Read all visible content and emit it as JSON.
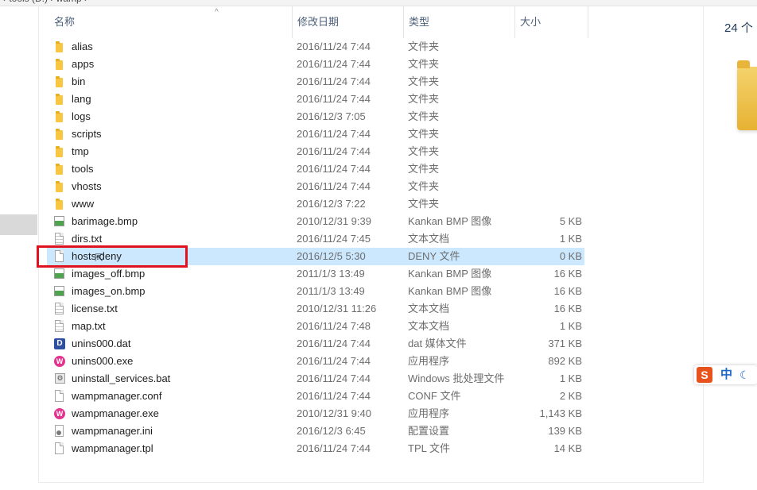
{
  "header": {
    "col_name": "名称",
    "col_date": "修改日期",
    "col_type": "类型",
    "col_size": "大小"
  },
  "files": [
    {
      "name": "alias",
      "date": "2016/11/24 7:44",
      "type": "文件夹",
      "size": "",
      "icon": "folder-icon"
    },
    {
      "name": "apps",
      "date": "2016/11/24 7:44",
      "type": "文件夹",
      "size": "",
      "icon": "folder-icon"
    },
    {
      "name": "bin",
      "date": "2016/11/24 7:44",
      "type": "文件夹",
      "size": "",
      "icon": "folder-icon"
    },
    {
      "name": "lang",
      "date": "2016/11/24 7:44",
      "type": "文件夹",
      "size": "",
      "icon": "folder-icon"
    },
    {
      "name": "logs",
      "date": "2016/12/3 7:05",
      "type": "文件夹",
      "size": "",
      "icon": "folder-icon"
    },
    {
      "name": "scripts",
      "date": "2016/11/24 7:44",
      "type": "文件夹",
      "size": "",
      "icon": "folder-icon"
    },
    {
      "name": "tmp",
      "date": "2016/11/24 7:44",
      "type": "文件夹",
      "size": "",
      "icon": "folder-icon"
    },
    {
      "name": "tools",
      "date": "2016/11/24 7:44",
      "type": "文件夹",
      "size": "",
      "icon": "folder-icon"
    },
    {
      "name": "vhosts",
      "date": "2016/11/24 7:44",
      "type": "文件夹",
      "size": "",
      "icon": "folder-icon"
    },
    {
      "name": "www",
      "date": "2016/12/3 7:22",
      "type": "文件夹",
      "size": "",
      "icon": "folder-icon"
    },
    {
      "name": "barimage.bmp",
      "date": "2010/12/31 9:39",
      "type": "Kankan BMP 图像",
      "size": "5 KB",
      "icon": "bmp-image-icon"
    },
    {
      "name": "dirs.txt",
      "date": "2016/11/24 7:45",
      "type": "文本文档",
      "size": "1 KB",
      "icon": "text-file-icon"
    },
    {
      "name": "hosts.deny",
      "date": "2016/12/5 5:30",
      "type": "DENY 文件",
      "size": "0 KB",
      "icon": "blank-file-icon",
      "selected": true
    },
    {
      "name": "images_off.bmp",
      "date": "2011/1/3 13:49",
      "type": "Kankan BMP 图像",
      "size": "16 KB",
      "icon": "bmp-image-icon"
    },
    {
      "name": "images_on.bmp",
      "date": "2011/1/3 13:49",
      "type": "Kankan BMP 图像",
      "size": "16 KB",
      "icon": "bmp-image-icon"
    },
    {
      "name": "license.txt",
      "date": "2010/12/31 11:26",
      "type": "文本文档",
      "size": "16 KB",
      "icon": "text-file-icon"
    },
    {
      "name": "map.txt",
      "date": "2016/11/24 7:48",
      "type": "文本文档",
      "size": "1 KB",
      "icon": "text-file-icon"
    },
    {
      "name": "unins000.dat",
      "date": "2016/11/24 7:44",
      "type": "dat 媒体文件",
      "size": "371 KB",
      "icon": "dat-file-icon"
    },
    {
      "name": "unins000.exe",
      "date": "2016/11/24 7:44",
      "type": "应用程序",
      "size": "892 KB",
      "icon": "exe-app-icon"
    },
    {
      "name": "uninstall_services.bat",
      "date": "2016/11/24 7:44",
      "type": "Windows 批处理文件",
      "size": "1 KB",
      "icon": "batch-file-icon"
    },
    {
      "name": "wampmanager.conf",
      "date": "2016/11/24 7:44",
      "type": "CONF 文件",
      "size": "2 KB",
      "icon": "blank-file-icon"
    },
    {
      "name": "wampmanager.exe",
      "date": "2010/12/31 9:40",
      "type": "应用程序",
      "size": "1,143 KB",
      "icon": "exe-app-icon"
    },
    {
      "name": "wampmanager.ini",
      "date": "2016/12/3 6:45",
      "type": "配置设置",
      "size": "139 KB",
      "icon": "config-file-icon"
    },
    {
      "name": "wampmanager.tpl",
      "date": "2016/11/24 7:44",
      "type": "TPL 文件",
      "size": "14 KB",
      "icon": "blank-file-icon"
    }
  ],
  "details": {
    "item_count": "24 个"
  },
  "ime": {
    "logo": "S",
    "lang": "中",
    "mode_icon": "moon-icon"
  },
  "colors": {
    "selection": "#cce8ff",
    "highlight_box": "#e0121f",
    "folder": "#f8c640"
  }
}
